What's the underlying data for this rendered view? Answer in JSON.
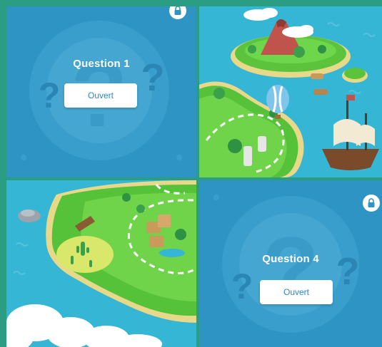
{
  "colors": {
    "frame": "#2a9d82",
    "tile_blue": "#2e94c4",
    "ocean": "#35b6d4",
    "grass": "#56c23a",
    "button_text": "#2e86c0"
  },
  "tiles": [
    {
      "id": 1,
      "type": "question",
      "title": "Question 1",
      "button_label": "Ouvert",
      "locked": true
    },
    {
      "id": 2,
      "type": "map",
      "scene": "island with volcano, hot-air balloon and pirate ship"
    },
    {
      "id": 3,
      "type": "map",
      "scene": "island coast with cactus, treasure area and clouds"
    },
    {
      "id": 4,
      "type": "question",
      "title": "Question 4",
      "button_label": "Ouvert",
      "locked": true
    }
  ],
  "icons": {
    "lock": "lock-icon",
    "question_mark": "question-mark-icon"
  }
}
